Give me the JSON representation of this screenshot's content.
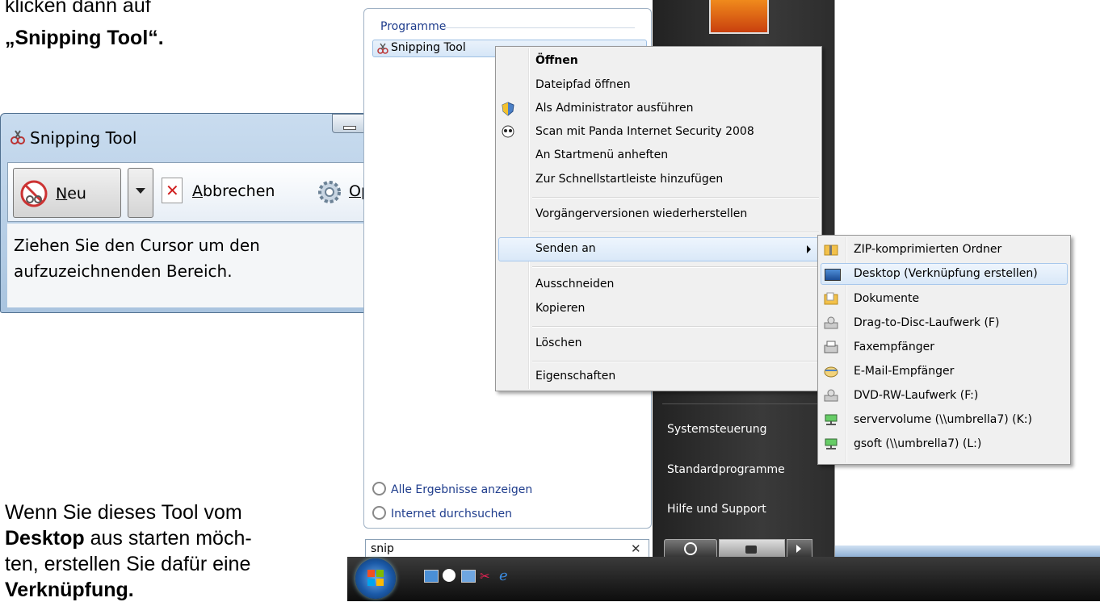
{
  "doc": {
    "line1": "klicken dann auf",
    "line2": "„Snipping Tool“.",
    "para2_a": "Wenn Sie dieses Tool vom",
    "para2_b_bold": "Desktop",
    "para2_b_rest": " aus starten möch-",
    "para2_c": "ten, erstellen Sie dafür eine",
    "para2_d": "Verknüpfung."
  },
  "snipping_tool": {
    "title": "Snipping Tool",
    "neu_accel": "N",
    "neu_rest": "eu",
    "abbrechen_accel": "A",
    "abbrechen_rest": "bbrechen",
    "optionen_accel": "O",
    "optionen_rest": "ptionen",
    "status_line1": "Ziehen Sie den Cursor um den",
    "status_line2": "aufzuzeichnenden Bereich."
  },
  "start_menu": {
    "group_header": "Programme",
    "program_item": "Snipping Tool",
    "all_results": "Alle Ergebnisse anzeigen",
    "internet_search": "Internet durchsuchen",
    "search_value": "snip",
    "right_items": [
      "Systemsteuerung",
      "Standardprogramme",
      "Hilfe und Support"
    ]
  },
  "context_menu": {
    "open": "Öffnen",
    "items": [
      "Dateipfad öffnen",
      "Als Administrator ausführen",
      "Scan mit Panda Internet Security 2008",
      "An Startmenü anheften",
      "Zur Schnellstartleiste hinzufügen",
      "Vorgängerversionen wiederherstellen",
      "Senden an",
      "Ausschneiden",
      "Kopieren",
      "Löschen",
      "Eigenschaften"
    ]
  },
  "send_to_menu": {
    "items": [
      "ZIP-komprimierten Ordner",
      "Desktop (Verknüpfung erstellen)",
      "Dokumente",
      "Drag-to-Disc-Laufwerk (F)",
      "Faxempfänger",
      "E-Mail-Empfänger",
      "DVD-RW-Laufwerk (F:)",
      "servervolume (\\\\umbrella7) (K:)",
      "gsoft (\\\\umbrella7) (L:)"
    ]
  },
  "colors": {
    "highlight": "#dbe9f8",
    "menu_bg": "#f0f0f0",
    "start_dark": "#2d2d2d"
  }
}
